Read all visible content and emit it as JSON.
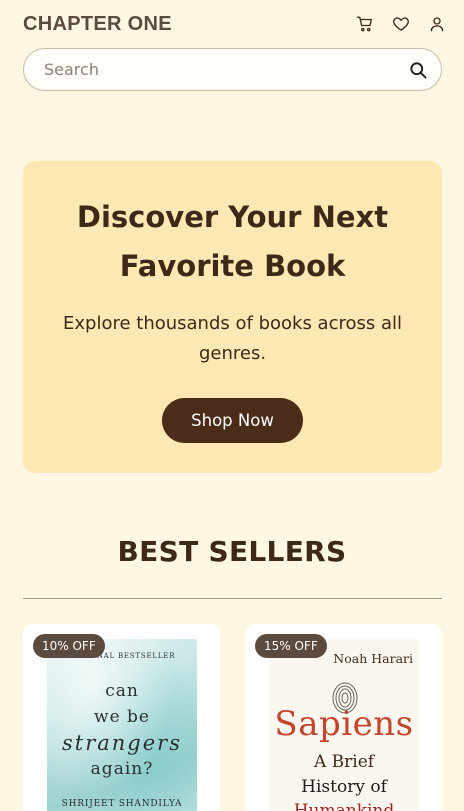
{
  "header": {
    "brand": "CHAPTER ONE",
    "icons": [
      "cart-icon",
      "heart-icon",
      "user-icon"
    ]
  },
  "search": {
    "placeholder": "Search",
    "value": ""
  },
  "hero": {
    "title": "Discover Your Next Favorite Book",
    "subtitle": "Explore thousands of books across all genres.",
    "cta_label": "Shop Now"
  },
  "bestsellers": {
    "title": "BEST SELLERS",
    "items": [
      {
        "discount": "10% OFF",
        "cover": {
          "tag": "NATIONAL BESTSELLER",
          "title_lines": [
            "can",
            "we be",
            "strangers",
            "again?"
          ],
          "author": "SHRIJEET SHANDILYA"
        }
      },
      {
        "discount": "15% OFF",
        "cover": {
          "author": "Noah Harari",
          "title": "Sapiens",
          "subtitle_lines": [
            "A Brief",
            "History of",
            "Humankind"
          ]
        }
      }
    ]
  },
  "colors": {
    "background": "#fff6e3",
    "hero_bg": "#ffe8b3",
    "primary_dark": "#4a2c18",
    "badge_bg": "#5b4a3e"
  }
}
